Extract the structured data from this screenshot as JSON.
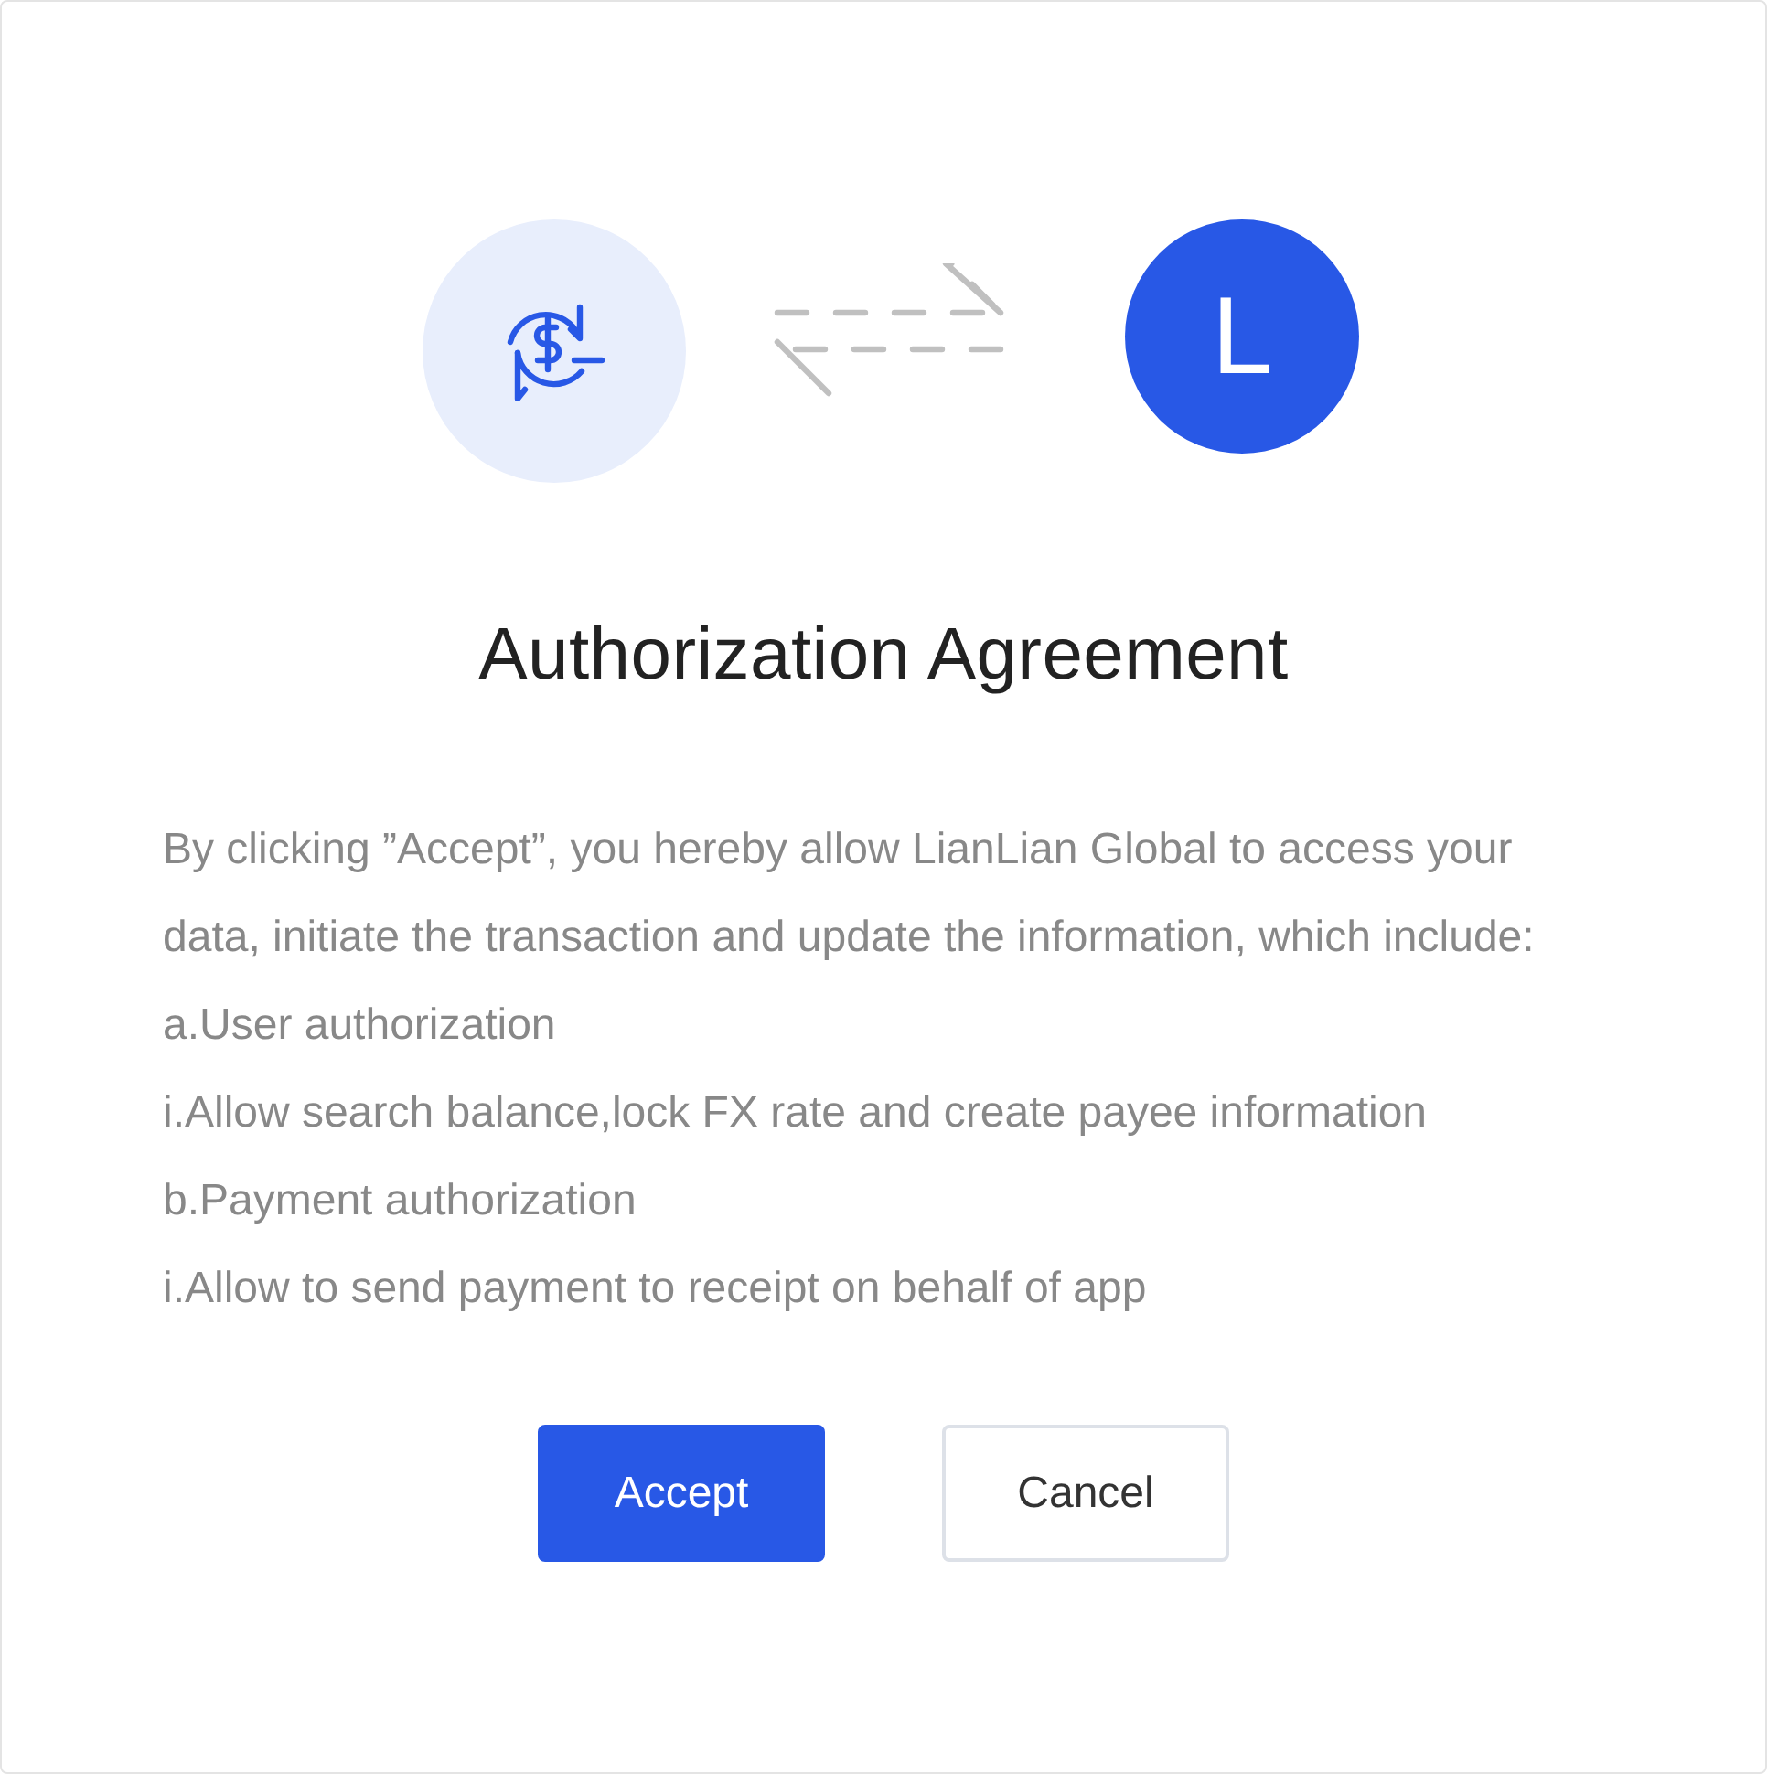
{
  "logos": {
    "partner_letter": "L"
  },
  "title": "Authorization Agreement",
  "paragraphs": [
    "By clicking ”Accept”, you hereby allow LianLian Global to access your data, initiate the transaction and update the information, which include:",
    "a.User authorization",
    "i.Allow search balance,lock FX rate and create payee information",
    "b.Payment authorization",
    "i.Allow to send payment to receipt on behalf of app"
  ],
  "buttons": [
    {
      "label": "Accept",
      "kind": "primary"
    },
    {
      "label": "Cancel",
      "kind": "secondary"
    }
  ]
}
